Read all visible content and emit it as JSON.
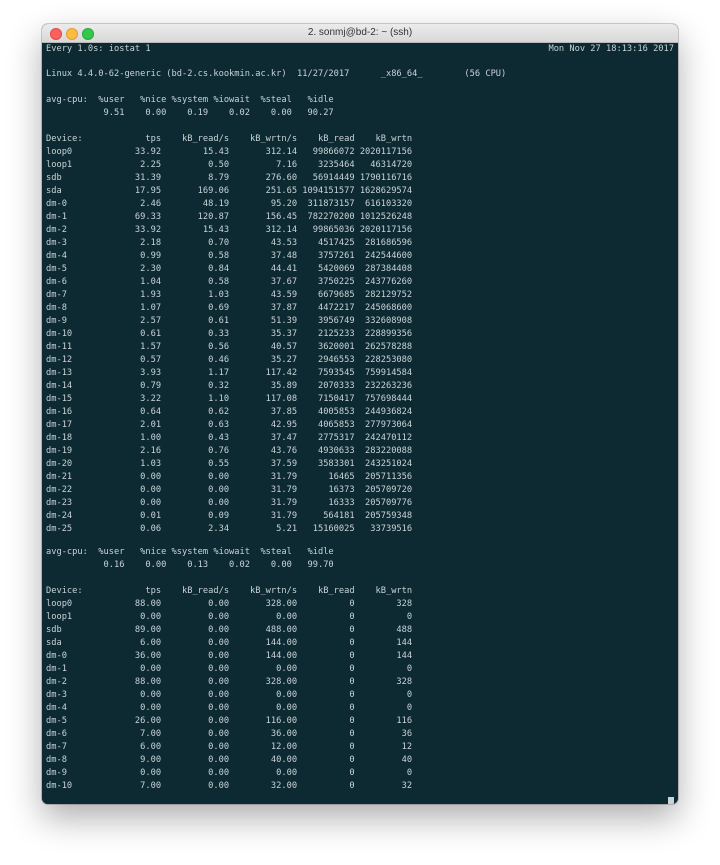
{
  "window": {
    "title": "2. sonmj@bd-2: ~ (ssh)"
  },
  "header": {
    "command": "Every 1.0s: iostat 1",
    "timestamp": "Mon Nov 27 18:13:16 2017"
  },
  "system_line": "Linux 4.4.0-62-generic (bd-2.cs.kookmin.ac.kr)  11/27/2017      _x86_64_        (56 CPU)",
  "report1": {
    "cpu_header": "avg-cpu:  %user   %nice %system %iowait  %steal   %idle",
    "cpu_values": "           9.51    0.00    0.19    0.02    0.00   90.27",
    "device_header": "Device:            tps    kB_read/s    kB_wrtn/s    kB_read    kB_wrtn",
    "rows": [
      "loop0            33.92        15.43       312.14   99866072 2020117156",
      "loop1             2.25         0.50         7.16    3235464   46314720",
      "sdb              31.39         8.79       276.60   56914449 1790116716",
      "sda              17.95       169.06       251.65 1094151577 1628629574",
      "dm-0              2.46        48.19        95.20  311873157  616103320",
      "dm-1             69.33       120.87       156.45  782270200 1012526248",
      "dm-2             33.92        15.43       312.14   99865036 2020117156",
      "dm-3              2.18         0.70        43.53    4517425  281686596",
      "dm-4              0.99         0.58        37.48    3757261  242544600",
      "dm-5              2.30         0.84        44.41    5420069  287384408",
      "dm-6              1.04         0.58        37.67    3750225  243776260",
      "dm-7              1.93         1.03        43.59    6679685  282129752",
      "dm-8              1.07         0.69        37.87    4472217  245068600",
      "dm-9              2.57         0.61        51.39    3956749  332608908",
      "dm-10             0.61         0.33        35.37    2125233  228899356",
      "dm-11             1.57         0.56        40.57    3620001  262578288",
      "dm-12             0.57         0.46        35.27    2946553  228253080",
      "dm-13             3.93         1.17       117.42    7593545  759914584",
      "dm-14             0.79         0.32        35.89    2070333  232263236",
      "dm-15             3.22         1.10       117.08    7150417  757698444",
      "dm-16             0.64         0.62        37.85    4005853  244936824",
      "dm-17             2.01         0.63        42.95    4065853  277973064",
      "dm-18             1.00         0.43        37.47    2775317  242470112",
      "dm-19             2.16         0.76        43.76    4930633  283220088",
      "dm-20             1.03         0.55        37.59    3583301  243251024",
      "dm-21             0.00         0.00        31.79      16465  205711356",
      "dm-22             0.00         0.00        31.79      16373  205709720",
      "dm-23             0.00         0.00        31.79      16333  205709776",
      "dm-24             0.01         0.09        31.79     564181  205759348",
      "dm-25             0.06         2.34         5.21   15160025   33739516"
    ]
  },
  "report2": {
    "cpu_header": "avg-cpu:  %user   %nice %system %iowait  %steal   %idle",
    "cpu_values": "           0.16    0.00    0.13    0.02    0.00   99.70",
    "device_header": "Device:            tps    kB_read/s    kB_wrtn/s    kB_read    kB_wrtn",
    "rows": [
      "loop0            88.00         0.00       328.00          0        328",
      "loop1             0.00         0.00         0.00          0          0",
      "sdb              89.00         0.00       488.00          0        488",
      "sda               6.00         0.00       144.00          0        144",
      "dm-0             36.00         0.00       144.00          0        144",
      "dm-1              0.00         0.00         0.00          0          0",
      "dm-2             88.00         0.00       328.00          0        328",
      "dm-3              0.00         0.00         0.00          0          0",
      "dm-4              0.00         0.00         0.00          0          0",
      "dm-5             26.00         0.00       116.00          0        116",
      "dm-6              7.00         0.00        36.00          0         36",
      "dm-7              6.00         0.00        12.00          0         12",
      "dm-8              9.00         0.00        40.00          0         40",
      "dm-9              0.00         0.00         0.00          0          0",
      "dm-10             7.00         0.00        32.00          0         32"
    ]
  },
  "colors": {
    "terminal_bg": "#0d2a33",
    "terminal_fg": "#c9d3d6"
  }
}
